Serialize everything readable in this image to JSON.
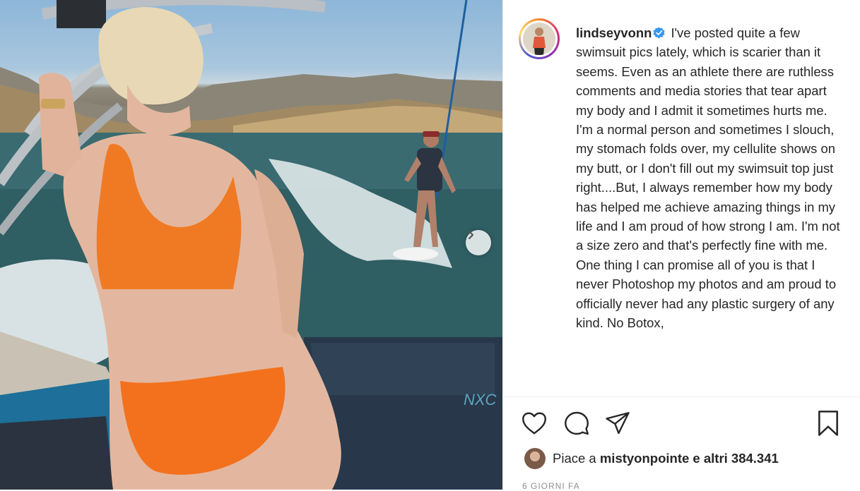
{
  "photo": {
    "alt_subject": "",
    "boat_brand_text": "NXC"
  },
  "post": {
    "username": "lindseyvonn",
    "verified": true,
    "caption": "I've posted quite a few swimsuit pics lately, which is scarier than it seems. Even as an athlete there are ruthless comments and media stories that tear apart my body and I admit it sometimes hurts me. I'm a normal person and sometimes I slouch, my stomach folds over, my cellulite shows on my butt, or I don't fill out my swimsuit top just right....But, I always remember how my body has helped me achieve amazing things in my life and I am proud of how strong I am.  I'm not a size zero and that's perfectly fine with me. One thing I can promise all of you is that I never Photoshop my photos and am proud to officially never had any plastic surgery of any kind. No Botox,"
  },
  "likes": {
    "prefix": "Piace a",
    "user": "mistyonpointe",
    "suffix": "e altri 384.341"
  },
  "timestamp": "6 GIORNI FA",
  "icons": {
    "like": "heart-icon",
    "comment": "comment-icon",
    "share": "paper-plane-icon",
    "save": "bookmark-icon",
    "next": "chevron-right-icon",
    "verified": "verified-badge-icon"
  },
  "colors": {
    "verified_blue": "#3897f0",
    "text": "#262626",
    "muted": "#8e8e8e"
  }
}
